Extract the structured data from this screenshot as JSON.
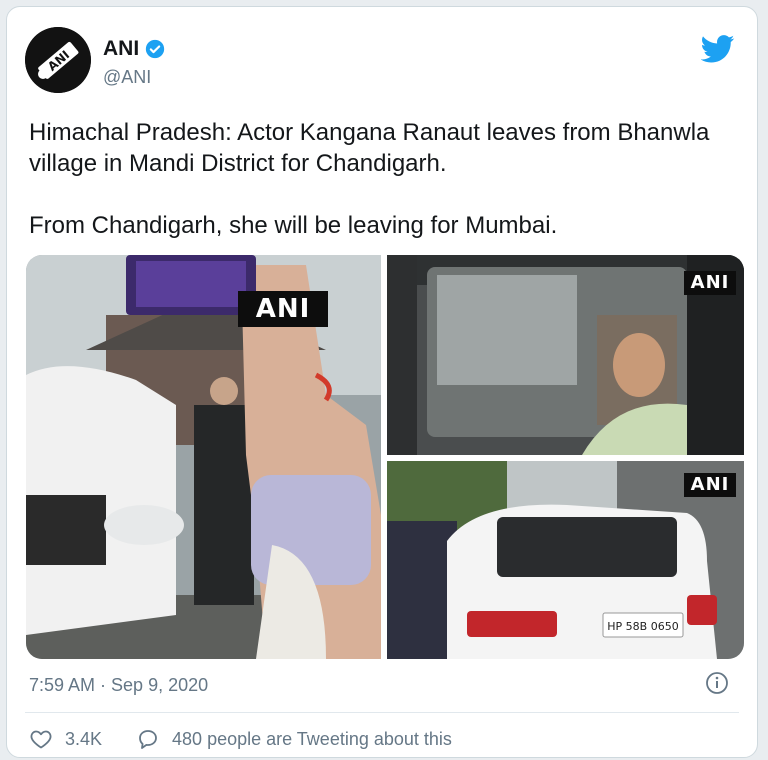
{
  "author": {
    "name": "ANI",
    "handle": "@ANI",
    "avatar_text": "ANI",
    "verified": true
  },
  "tweet": {
    "paragraphs": [
      "Himachal Pradesh: Actor Kangana Ranaut leaves from Bhanwla village in Mandi District for Chandigarh.",
      "From Chandigarh, she will be leaving for Mumbai."
    ],
    "timestamp": "7:59 AM · Sep 9, 2020"
  },
  "media": {
    "watermark": "ANI",
    "photos": [
      {
        "description_icon": "photo-icon"
      },
      {
        "description_icon": "photo-icon"
      },
      {
        "description_icon": "photo-icon"
      }
    ],
    "license_plate": "HP 58B 0650"
  },
  "actions": {
    "likes": "3.4K",
    "conversation": "480 people are Tweeting about this"
  },
  "colors": {
    "brand_blue": "#1da1f2",
    "text_primary": "#14171a",
    "text_secondary": "#657786",
    "border": "#cfd9de"
  }
}
